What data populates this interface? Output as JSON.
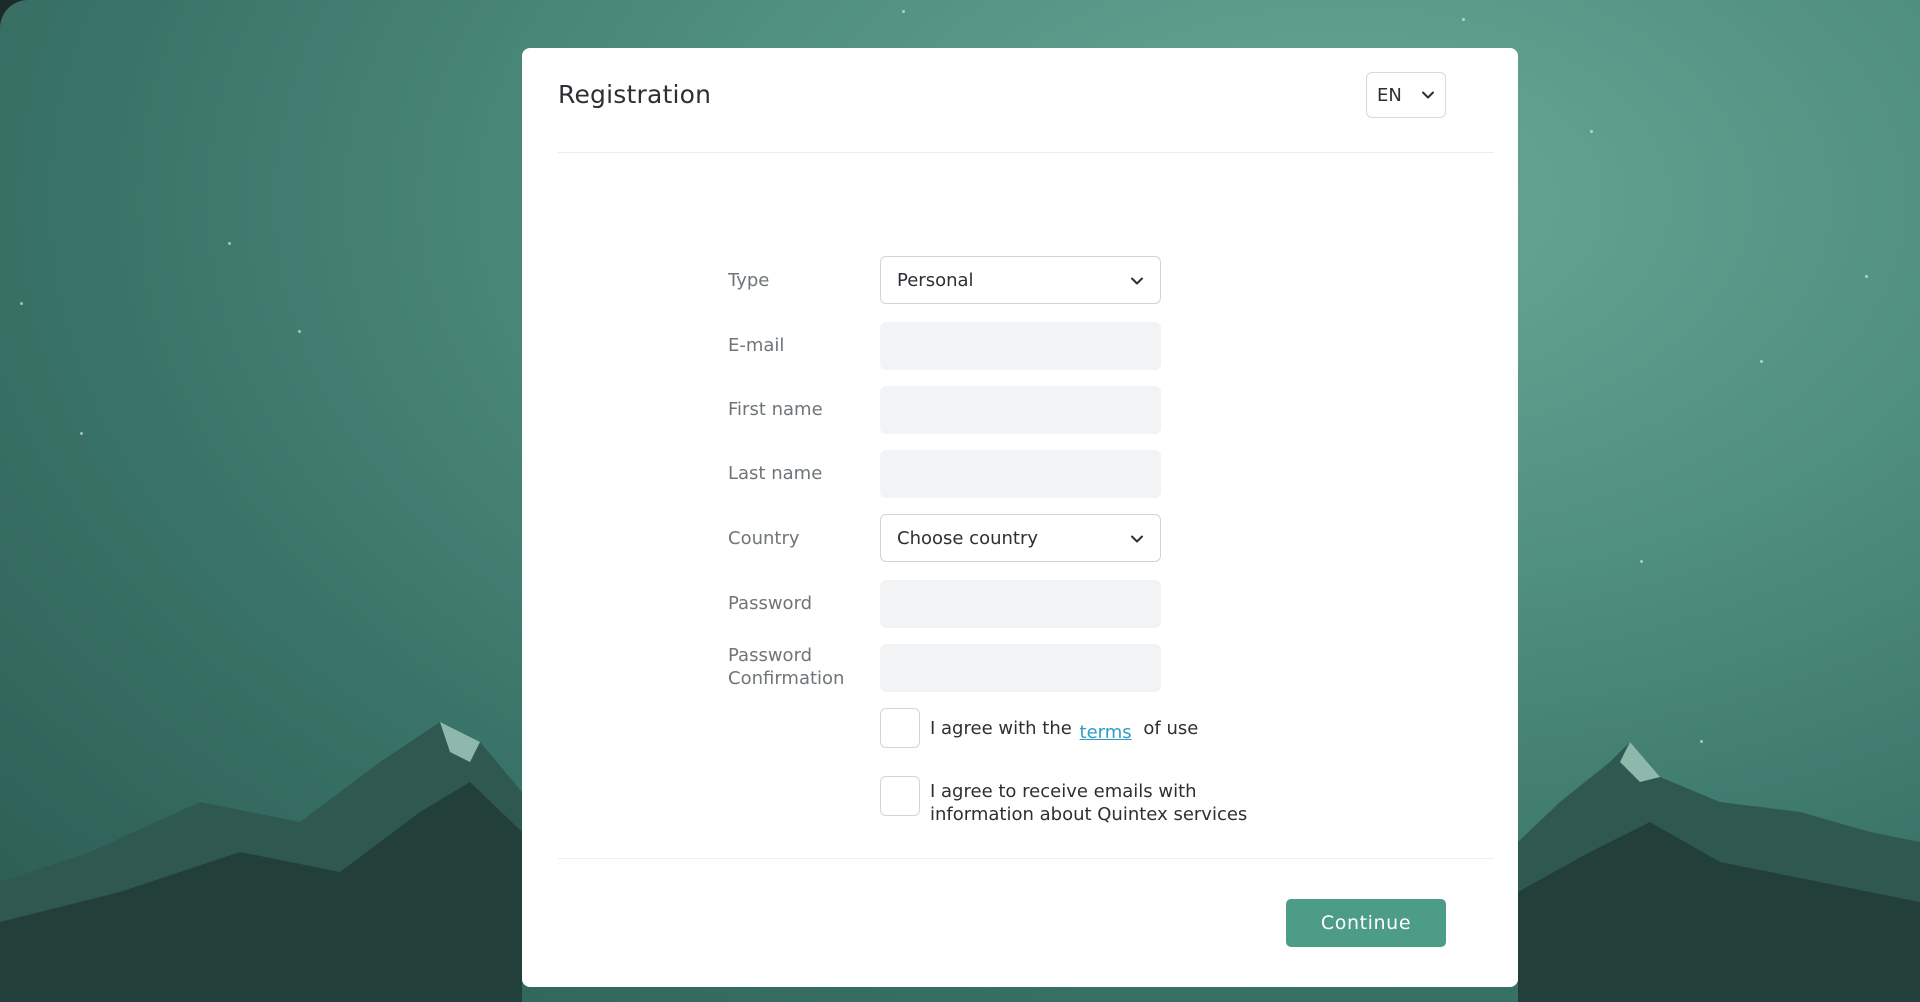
{
  "colors": {
    "accent": "#4c9c88",
    "link": "#2f9dc4",
    "label": "#6f7579",
    "text": "#2c3034",
    "input_bg": "#f1f3f5"
  },
  "header": {
    "title": "Registration",
    "language": {
      "value": "EN",
      "icon": "chevron-down-icon"
    }
  },
  "form": {
    "type": {
      "label": "Type",
      "value": "Personal",
      "icon": "chevron-down-icon"
    },
    "email": {
      "label": "E-mail",
      "value": ""
    },
    "first_name": {
      "label": "First name",
      "value": ""
    },
    "last_name": {
      "label": "Last name",
      "value": ""
    },
    "country": {
      "label": "Country",
      "value": "Choose country",
      "icon": "chevron-down-icon"
    },
    "password": {
      "label": "Password",
      "value": ""
    },
    "password_confirmation": {
      "label_line1": "Password",
      "label_line2": "Confirmation",
      "value": ""
    },
    "terms": {
      "checked": false,
      "text_before": "I agree with the",
      "link": "terms",
      "text_after": "of use"
    },
    "newsletter": {
      "checked": false,
      "line1": "I agree to receive emails with",
      "line2": "information about Quintex services"
    }
  },
  "footer": {
    "continue_label": "Continue"
  }
}
